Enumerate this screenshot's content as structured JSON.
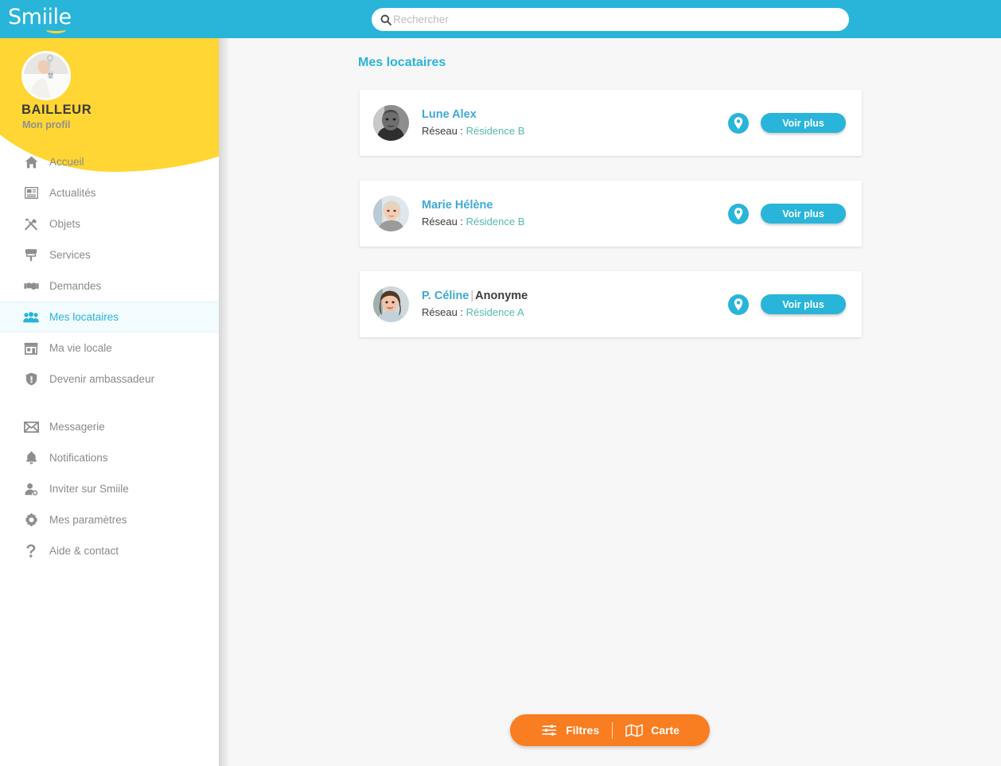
{
  "topbar": {
    "logo_text": "Smiile",
    "logo_icon": "smiile-logo",
    "search": {
      "icon": "search-icon",
      "placeholder": "Rechercher",
      "value": ""
    }
  },
  "sidebar": {
    "profile": {
      "avatar_icon": "profile-avatar-keys-photo",
      "name": "BAILLEUR",
      "subtitle": "Mon profil"
    },
    "items": [
      {
        "label": "Accueil",
        "icon": "home-icon",
        "active": false
      },
      {
        "label": "Actualités",
        "icon": "newspaper-icon",
        "active": false
      },
      {
        "label": "Objets",
        "icon": "tools-icon",
        "active": false
      },
      {
        "label": "Services",
        "icon": "paintbrush-icon",
        "active": false
      },
      {
        "label": "Demandes",
        "icon": "handshake-icon",
        "active": false
      },
      {
        "label": "Mes locataires",
        "icon": "users-icon",
        "active": true
      },
      {
        "label": "Ma vie locale",
        "icon": "shop-icon",
        "active": false
      },
      {
        "label": "Devenir ambassadeur",
        "icon": "shield-icon",
        "active": false
      }
    ],
    "items_secondary": [
      {
        "label": "Messagerie",
        "icon": "envelope-icon"
      },
      {
        "label": "Notifications",
        "icon": "bell-icon"
      },
      {
        "label": "Inviter sur Smiile",
        "icon": "user-add-icon"
      },
      {
        "label": "Mes paramètres",
        "icon": "gear-icon"
      },
      {
        "label": "Aide & contact",
        "icon": "question-mark-icon"
      }
    ]
  },
  "main": {
    "page_title": "Mes locataires",
    "network_label": "Réseau :",
    "pin_icon": "map-pin-icon",
    "view_more_label": "Voir plus",
    "tenants": [
      {
        "name": "Lune Alex",
        "anonymous_label": "",
        "separator": "",
        "network": "Résidence B",
        "avatar_icon": "tenant-avatar-photo-1"
      },
      {
        "name": "Marie Hélène",
        "anonymous_label": "",
        "separator": "",
        "network": "Résidence B",
        "avatar_icon": "tenant-avatar-photo-2"
      },
      {
        "name": "P. Céline",
        "anonymous_label": "Anonyme",
        "separator": "|",
        "network": "Résidence A",
        "avatar_icon": "tenant-avatar-photo-3"
      }
    ]
  },
  "fab": {
    "filters_label": "Filtres",
    "filters_icon": "sliders-icon",
    "map_label": "Carte",
    "map_icon": "map-icon"
  },
  "colors": {
    "brand_blue": "#29b4da",
    "brand_yellow": "#ffd633",
    "orange": "#f97d21",
    "teal": "#55b8ad",
    "page_bg": "#f7f7f7"
  }
}
